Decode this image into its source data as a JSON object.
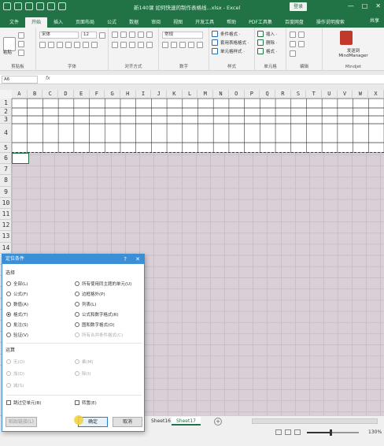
{
  "window": {
    "title": "新140课 如何快速的制作表格线...xlsx - Excel",
    "signin_label": "登录",
    "controls": [
      "—",
      "□",
      "✕"
    ]
  },
  "ribbon_tabs": [
    "文件",
    "开始",
    "插入",
    "页面布局",
    "公式",
    "数据",
    "审阅",
    "视图",
    "开发工具",
    "帮助",
    "PDF工具集",
    "百度网盘",
    "操作说明搜索"
  ],
  "ribbon_share": "共享",
  "ribbon": {
    "clipboard": {
      "label": "剪贴板",
      "paste": "粘贴"
    },
    "font": {
      "label": "字体",
      "name": "宋体",
      "size": "12"
    },
    "alignment": {
      "label": "对齐方式"
    },
    "number": {
      "label": "数字",
      "format": "常规"
    },
    "styles": {
      "label": "样式",
      "items": [
        "条件格式 ·",
        "套用表格格式 ·",
        "单元格样式 ·"
      ]
    },
    "cells": {
      "label": "单元格",
      "items": [
        "插入 ·",
        "删除 ·",
        "格式 ·"
      ]
    },
    "editing": {
      "label": "编辑"
    },
    "mindjet": {
      "label": "Mindjet",
      "send_line1": "发送到",
      "send_line2": "MindManager"
    }
  },
  "formula_bar": {
    "name_box": "A6",
    "fx": "fx"
  },
  "columns": [
    "A",
    "B",
    "C",
    "D",
    "E",
    "F",
    "G",
    "H",
    "I",
    "J",
    "K",
    "L",
    "M",
    "N",
    "O",
    "P",
    "Q",
    "R",
    "S",
    "T",
    "U",
    "V",
    "W",
    "X"
  ],
  "rows": [
    "1",
    "2",
    "3",
    "4",
    "5",
    "6",
    "7",
    "8",
    "9",
    "10",
    "11",
    "12",
    "13",
    "14",
    "15",
    "16",
    "17",
    "18",
    "19",
    "20",
    "21",
    "22",
    "23",
    "24"
  ],
  "sheet_tabs": [
    "Sheet16",
    "Sheet17"
  ],
  "active_sheet": "Sheet17",
  "add_sheet": "+",
  "status": {
    "zoom": "130%",
    "zoom_fraction": 0.45
  },
  "dialog": {
    "title": "定位条件",
    "help": "?",
    "close": "✕",
    "section_select": "选择",
    "left_options": [
      "批注(C)",
      "常量(O)",
      "公式(F)",
      "数字(U)",
      "文本(X)",
      "逻辑值(G)",
      "错误(E)",
      "空值(K)",
      "当前区域(R)",
      "当前数组(A)",
      "对象(B)"
    ],
    "left_visible": [
      "全部(L)",
      "公式(F)",
      "数值(A)",
      "格式(T)",
      "批注(S)",
      "验证(V)"
    ],
    "left_selected_index": 3,
    "right_visible": [
      "所有使用同主题的单元(U)",
      "边框格外(P)",
      "列表(L)",
      "公式和数字格式(R)",
      "图和数字格式(O)",
      "所有合并条件格式(C)"
    ],
    "right_disabled_index": 5,
    "section_operation": "运算",
    "op_left": [
      "无(O)",
      "加(D)",
      "减(S)"
    ],
    "op_right": [
      "乘(M)",
      "除(I)"
    ],
    "skip_blanks": "跳过空单元(B)",
    "transpose": "转置(E)",
    "paste_link": "粘贴链接(L)",
    "ok": "确定",
    "cancel": "取消"
  }
}
